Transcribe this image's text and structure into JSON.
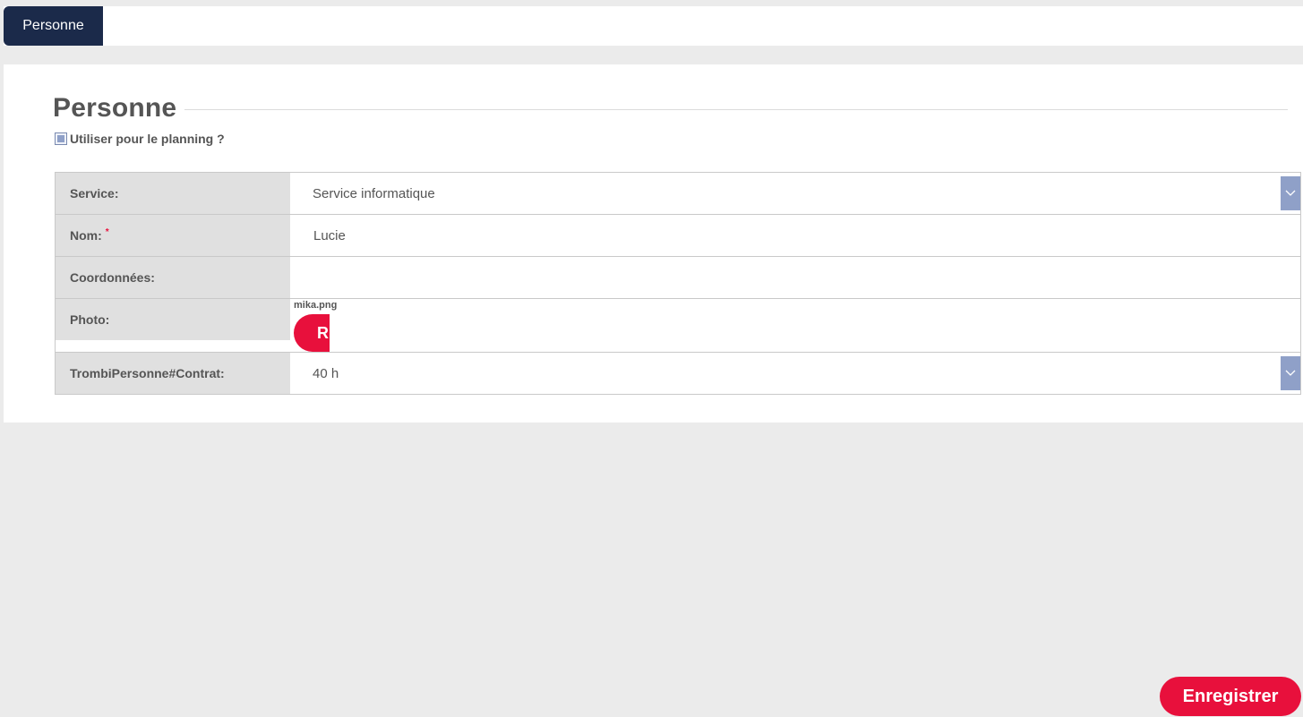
{
  "tabs": [
    {
      "label": "Personne",
      "active": true
    }
  ],
  "section": {
    "title": "Personne"
  },
  "planning": {
    "label": "Utiliser pour le planning ?",
    "checked": false
  },
  "form": {
    "service": {
      "label": "Service:",
      "value": "Service informatique"
    },
    "nom": {
      "label": "Nom:",
      "required_mark": "*",
      "value": "Lucie"
    },
    "coordonnees": {
      "label": "Coordonnées:",
      "value": ""
    },
    "photo": {
      "label": "Photo:",
      "file_name": "mika.png",
      "button_label": "R"
    },
    "contrat": {
      "label": "TrombiPersonne#Contrat:",
      "value": "40 h"
    }
  },
  "actions": {
    "save_label": "Enregistrer"
  },
  "colors": {
    "tab_bg": "#1b2a4a",
    "accent": "#e8103c",
    "select_arrow": "#8fa0c8"
  },
  "icons": {
    "select_arrow": "chevron-down-icon"
  }
}
